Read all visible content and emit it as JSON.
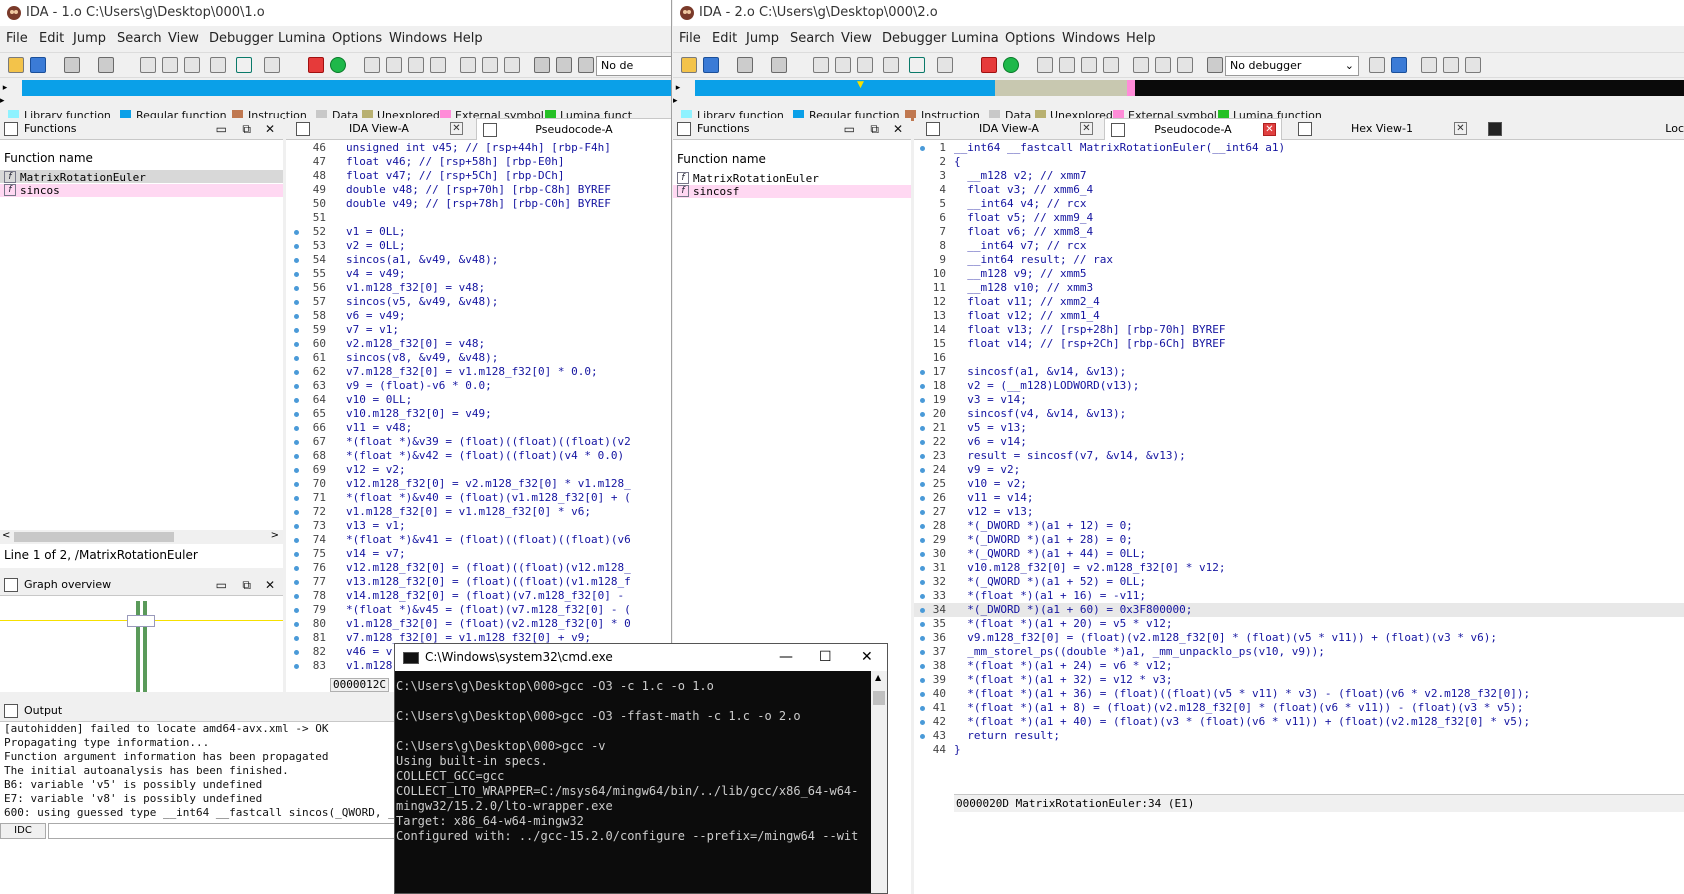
{
  "colors": {
    "library": "#8ff2ff",
    "regular": "#0aa0e8",
    "instruction": "#c07850",
    "data": "#c8c8c8",
    "unexplored": "#b8b070",
    "external": "#ff8cd8",
    "lumina": "#25c025",
    "code_text": "#1414a0",
    "comment": "#7a7ad0"
  },
  "w1": {
    "title": "IDA - 1.o C:\\Users\\g\\Desktop\\000\\1.o",
    "menu": [
      "File",
      "Edit",
      "Jump",
      "Search",
      "View",
      "Debugger",
      "Lumina",
      "Options",
      "Windows",
      "Help"
    ],
    "debugger": "No de",
    "legend": [
      "Library function",
      "Regular function",
      "Instruction",
      "Data",
      "Unexplored",
      "External symbol",
      "Lumina funct"
    ],
    "functions": {
      "title": "Functions",
      "col": "Function name",
      "rows": [
        "MatrixRotationEuler",
        "sincos"
      ],
      "status": "Line 1 of 2, /MatrixRotationEuler"
    },
    "graph": {
      "title": "Graph overview"
    },
    "tabs": [
      "IDA View-A",
      "Pseudocode-A"
    ],
    "code": [
      {
        "n": "46",
        "t": "unsigned int v45; // [rsp+44h] [rbp-F4h]"
      },
      {
        "n": "47",
        "t": "float v46; // [rsp+58h] [rbp-E0h]"
      },
      {
        "n": "48",
        "t": "float v47; // [rsp+5Ch] [rbp-DCh]"
      },
      {
        "n": "49",
        "t": "double v48; // [rsp+70h] [rbp-C8h] BYREF"
      },
      {
        "n": "50",
        "t": "double v49; // [rsp+78h] [rbp-C0h] BYREF"
      },
      {
        "n": "51",
        "t": ""
      },
      {
        "n": "52",
        "t": "v1 = 0LL;"
      },
      {
        "n": "53",
        "t": "v2 = 0LL;"
      },
      {
        "n": "54",
        "t": "sincos(a1, &v49, &v48);"
      },
      {
        "n": "55",
        "t": "v4 = v49;"
      },
      {
        "n": "56",
        "t": "v1.m128_f32[0] = v48;"
      },
      {
        "n": "57",
        "t": "sincos(v5, &v49, &v48);"
      },
      {
        "n": "58",
        "t": "v6 = v49;"
      },
      {
        "n": "59",
        "t": "v7 = v1;"
      },
      {
        "n": "60",
        "t": "v2.m128_f32[0] = v48;"
      },
      {
        "n": "61",
        "t": "sincos(v8, &v49, &v48);"
      },
      {
        "n": "62",
        "t": "v7.m128_f32[0] = v1.m128_f32[0] * 0.0;"
      },
      {
        "n": "63",
        "t": "v9 = (float)-v6 * 0.0;"
      },
      {
        "n": "64",
        "t": "v10 = 0LL;"
      },
      {
        "n": "65",
        "t": "v10.m128_f32[0] = v49;"
      },
      {
        "n": "66",
        "t": "v11 = v48;"
      },
      {
        "n": "67",
        "t": "*(float *)&v39 = (float)((float)((float)(v2"
      },
      {
        "n": "68",
        "t": "*(float *)&v42 = (float)((float)(v4 * 0.0)"
      },
      {
        "n": "69",
        "t": "v12 = v2;"
      },
      {
        "n": "70",
        "t": "v12.m128_f32[0] = v2.m128_f32[0] * v1.m128_"
      },
      {
        "n": "71",
        "t": "*(float *)&v40 = (float)(v1.m128_f32[0] + ("
      },
      {
        "n": "72",
        "t": "v1.m128_f32[0] = v1.m128_f32[0] * v6;"
      },
      {
        "n": "73",
        "t": "v13 = v1;"
      },
      {
        "n": "74",
        "t": "*(float *)&v41 = (float)((float)((float)(v6"
      },
      {
        "n": "75",
        "t": "v14 = v7;"
      },
      {
        "n": "76",
        "t": "v12.m128_f32[0] = (float)((float)(v12.m128_"
      },
      {
        "n": "77",
        "t": "v13.m128_f32[0] = (float)((float)(v1.m128_f"
      },
      {
        "n": "78",
        "t": "v14.m128_f32[0] = (float)(v7.m128_f32[0] -"
      },
      {
        "n": "79",
        "t": "*(float *)&v45 = (float)(v7.m128_f32[0] - ("
      },
      {
        "n": "80",
        "t": "v1.m128_f32[0] = (float)(v2.m128_f32[0] * 0"
      },
      {
        "n": "81",
        "t": "v7.m128_f32[0] = v1.m128_f32[0] + v9;"
      },
      {
        "n": "82",
        "t": "v46 = v"
      },
      {
        "n": "83",
        "t": "v1.m128"
      }
    ],
    "addr": "0000012C",
    "output": {
      "title": "Output",
      "lines": [
        "[autohidden] failed to locate amd64-avx.xml -> OK",
        "Propagating type information...",
        "Function argument information has been propagated",
        "The initial autoanalysis has been finished.",
        "B6: variable 'v5' is possibly undefined",
        "E7: variable 'v8' is possibly undefined",
        "600: using guessed type __int64 __fastcall sincos(_QWORD, _"
      ],
      "prompt": "IDC"
    }
  },
  "w2": {
    "title": "IDA - 2.o C:\\Users\\g\\Desktop\\000\\2.o",
    "menu": [
      "File",
      "Edit",
      "Jump",
      "Search",
      "View",
      "Debugger",
      "Lumina",
      "Options",
      "Windows",
      "Help"
    ],
    "debugger": "No debugger",
    "legend": [
      "Library function",
      "Regular function",
      "Instruction",
      "Data",
      "Unexplored",
      "External symbol",
      "Lumina function"
    ],
    "functions": {
      "title": "Functions",
      "col": "Function name",
      "rows": [
        "MatrixRotationEuler",
        "sincosf"
      ]
    },
    "tabs": [
      "IDA View-A",
      "Pseudocode-A",
      "Hex View-1",
      "Loc"
    ],
    "code": [
      {
        "n": "1",
        "t": "__int64 __fastcall MatrixRotationEuler(__int64 a1)"
      },
      {
        "n": "2",
        "t": "{"
      },
      {
        "n": "3",
        "t": "  __m128 v2; // xmm7"
      },
      {
        "n": "4",
        "t": "  float v3; // xmm6_4"
      },
      {
        "n": "5",
        "t": "  __int64 v4; // rcx"
      },
      {
        "n": "6",
        "t": "  float v5; // xmm9_4"
      },
      {
        "n": "7",
        "t": "  float v6; // xmm8_4"
      },
      {
        "n": "8",
        "t": "  __int64 v7; // rcx"
      },
      {
        "n": "9",
        "t": "  __int64 result; // rax"
      },
      {
        "n": "10",
        "t": "  __m128 v9; // xmm5"
      },
      {
        "n": "11",
        "t": "  __m128 v10; // xmm3"
      },
      {
        "n": "12",
        "t": "  float v11; // xmm2_4"
      },
      {
        "n": "13",
        "t": "  float v12; // xmm1_4"
      },
      {
        "n": "14",
        "t": "  float v13; // [rsp+28h] [rbp-70h] BYREF"
      },
      {
        "n": "15",
        "t": "  float v14; // [rsp+2Ch] [rbp-6Ch] BYREF"
      },
      {
        "n": "16",
        "t": ""
      },
      {
        "n": "17",
        "t": "  sincosf(a1, &v14, &v13);"
      },
      {
        "n": "18",
        "t": "  v2 = (__m128)LODWORD(v13);"
      },
      {
        "n": "19",
        "t": "  v3 = v14;"
      },
      {
        "n": "20",
        "t": "  sincosf(v4, &v14, &v13);"
      },
      {
        "n": "21",
        "t": "  v5 = v13;"
      },
      {
        "n": "22",
        "t": "  v6 = v14;"
      },
      {
        "n": "23",
        "t": "  result = sincosf(v7, &v14, &v13);"
      },
      {
        "n": "24",
        "t": "  v9 = v2;"
      },
      {
        "n": "25",
        "t": "  v10 = v2;"
      },
      {
        "n": "26",
        "t": "  v11 = v14;"
      },
      {
        "n": "27",
        "t": "  v12 = v13;"
      },
      {
        "n": "28",
        "t": "  *(_DWORD *)(a1 + 12) = 0;"
      },
      {
        "n": "29",
        "t": "  *(_DWORD *)(a1 + 28) = 0;"
      },
      {
        "n": "30",
        "t": "  *(_QWORD *)(a1 + 44) = 0LL;"
      },
      {
        "n": "31",
        "t": "  v10.m128_f32[0] = v2.m128_f32[0] * v12;"
      },
      {
        "n": "32",
        "t": "  *(_QWORD *)(a1 + 52) = 0LL;"
      },
      {
        "n": "33",
        "t": "  *(float *)(a1 + 16) = -v11;"
      },
      {
        "n": "34",
        "t": "  *(_DWORD *)(a1 + 60) = 0x3F800000;"
      },
      {
        "n": "35",
        "t": "  *(float *)(a1 + 20) = v5 * v12;"
      },
      {
        "n": "36",
        "t": "  v9.m128_f32[0] = (float)(v2.m128_f32[0] * (float)(v5 * v11)) + (float)(v3 * v6);"
      },
      {
        "n": "37",
        "t": "  _mm_storel_ps((double *)a1, _mm_unpacklo_ps(v10, v9));"
      },
      {
        "n": "38",
        "t": "  *(float *)(a1 + 24) = v6 * v12;"
      },
      {
        "n": "39",
        "t": "  *(float *)(a1 + 32) = v12 * v3;"
      },
      {
        "n": "40",
        "t": "  *(float *)(a1 + 36) = (float)((float)(v5 * v11) * v3) - (float)(v6 * v2.m128_f32[0]);"
      },
      {
        "n": "41",
        "t": "  *(float *)(a1 + 8) = (float)(v2.m128_f32[0] * (float)(v6 * v11)) - (float)(v3 * v5);"
      },
      {
        "n": "42",
        "t": "  *(float *)(a1 + 40) = (float)(v3 * (float)(v6 * v11)) + (float)(v2.m128_f32[0] * v5);"
      },
      {
        "n": "43",
        "t": "  return result;"
      },
      {
        "n": "44",
        "t": "}"
      }
    ],
    "status": "0000020D MatrixRotationEuler:34 (E1)"
  },
  "cmd": {
    "title": "C:\\Windows\\system32\\cmd.exe",
    "lines": [
      "C:\\Users\\g\\Desktop\\000>gcc -O3 -c 1.c -o 1.o",
      "",
      "C:\\Users\\g\\Desktop\\000>gcc -O3 -ffast-math -c 1.c -o 2.o",
      "",
      "C:\\Users\\g\\Desktop\\000>gcc -v",
      "Using built-in specs.",
      "COLLECT_GCC=gcc",
      "COLLECT_LTO_WRAPPER=C:/msys64/mingw64/bin/../lib/gcc/x86_64-w64-",
      "mingw32/15.2.0/lto-wrapper.exe",
      "Target: x86_64-w64-mingw32",
      "Configured with: ../gcc-15.2.0/configure --prefix=/mingw64 --wit"
    ]
  }
}
